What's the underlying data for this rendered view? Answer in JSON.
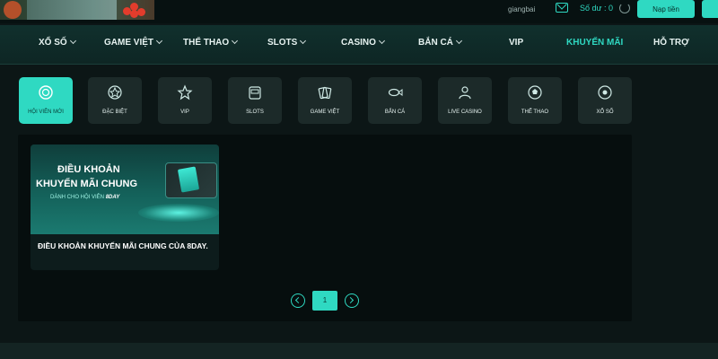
{
  "header": {
    "username": "giangbai",
    "balance_text": "Số dư : 0",
    "deposit_label": "Nạp tiền"
  },
  "nav": {
    "items": [
      {
        "label": "XỔ SỐ",
        "has_caret": true
      },
      {
        "label": "GAME VIỆT",
        "has_caret": true
      },
      {
        "label": "THỂ THAO",
        "has_caret": true
      },
      {
        "label": "SLOTS",
        "has_caret": true
      },
      {
        "label": "CASINO",
        "has_caret": true
      },
      {
        "label": "BẮN CÁ",
        "has_caret": true
      },
      {
        "label": "VIP",
        "has_caret": false
      },
      {
        "label": "KHUYẾN MÃI",
        "has_caret": false,
        "active": true
      },
      {
        "label": "HỖ TRỢ",
        "has_caret": false
      }
    ]
  },
  "categories": [
    {
      "label": "HỘI VIÊN MỚI",
      "icon": "badge-icon",
      "active": true
    },
    {
      "label": "ĐẶC BIỆT",
      "icon": "star-badge-icon"
    },
    {
      "label": "VIP",
      "icon": "star-icon"
    },
    {
      "label": "SLOTS",
      "icon": "slot-machine-icon"
    },
    {
      "label": "GAME VIỆT",
      "icon": "cards-icon"
    },
    {
      "label": "BẮN CÁ",
      "icon": "fish-icon"
    },
    {
      "label": "LIVE CASINO",
      "icon": "dealer-icon"
    },
    {
      "label": "THỂ THAO",
      "icon": "soccer-ball-icon"
    },
    {
      "label": "XỔ SỐ",
      "icon": "lottery-ball-icon"
    }
  ],
  "promo": {
    "banner_line1": "ĐIỀU KHOẢN",
    "banner_line2": "KHUYẾN MÃI CHUNG",
    "banner_line3": "DÀNH CHO HỘI VIÊN",
    "banner_brand": "8DAY",
    "title": "ĐIỀU KHOẢN KHUYẾN MÃI CHUNG CỦA 8DAY."
  },
  "pagination": {
    "current_page": "1"
  },
  "colors": {
    "accent": "#2fd9c2",
    "background": "#0c1616",
    "panel": "#060e0e",
    "tile": "#1c2a29"
  }
}
